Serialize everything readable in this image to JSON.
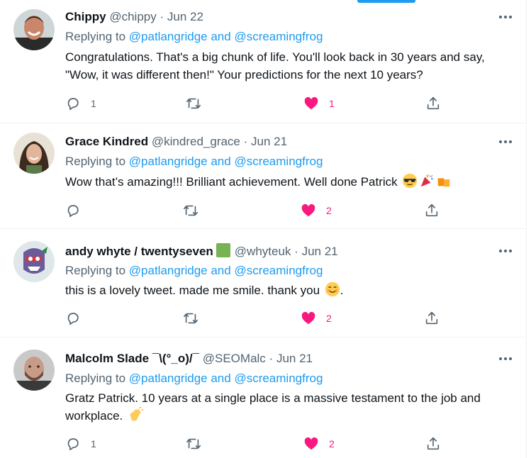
{
  "tweets": [
    {
      "name": "Chippy",
      "handle": "@chippy",
      "sep": "·",
      "date": "Jun 22",
      "replying_prefix": "Replying to",
      "replying_targets": "@patlangridge and @screamingfrog",
      "text": "Congratulations. That's a big chunk of life. You'll look back in 30 years and say, \"Wow, it was different then!\" Your predictions for the next 10 years?",
      "reply_count": "1",
      "retweet_count": "",
      "like_count": "1"
    },
    {
      "name": "Grace Kindred",
      "handle": "@kindred_grace",
      "sep": "·",
      "date": "Jun 21",
      "replying_prefix": "Replying to",
      "replying_targets": "@patlangridge and @screamingfrog",
      "text": "Wow that’s amazing!!! Brilliant achievement. Well done Patrick",
      "reply_count": "",
      "retweet_count": "",
      "like_count": "2"
    },
    {
      "name": "andy whyte / twentyseven",
      "handle": "@whyteuk",
      "sep": "·",
      "date": "Jun 21",
      "replying_prefix": "Replying to",
      "replying_targets": "@patlangridge and @screamingfrog",
      "text": "this is a lovely tweet. made me smile. thank you",
      "text_suffix": ".",
      "reply_count": "",
      "retweet_count": "",
      "like_count": "2"
    },
    {
      "name": "Malcolm Slade ¯\\(°_o)/¯",
      "handle": "@SEOMalc",
      "sep": "·",
      "date": "Jun 21",
      "replying_prefix": "Replying to",
      "replying_targets": "@patlangridge and @screamingfrog",
      "text": "Gratz Patrick. 10 years at a single place is a massive testament to the job and workplace.",
      "reply_count": "1",
      "retweet_count": "",
      "like_count": "2"
    }
  ],
  "colors": {
    "accent": "#1d9bf0",
    "like": "#f91880",
    "muted": "#536471",
    "text": "#0f1419"
  },
  "icons": [
    "reply-icon",
    "retweet-icon",
    "heart-icon",
    "share-icon",
    "more-icon"
  ]
}
